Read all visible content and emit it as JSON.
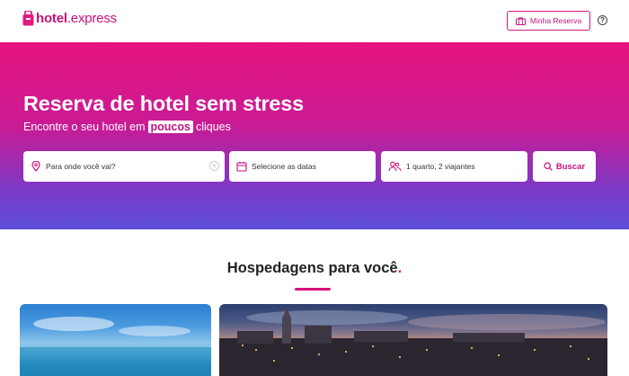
{
  "header": {
    "logo_brand": "hotel",
    "logo_suffix": ".express",
    "my_reservation_label": "Minha Reserva",
    "help_symbol": "?"
  },
  "hero": {
    "title": "Reserva de hotel sem stress",
    "subtitle_before": "Encontre o seu hotel em",
    "subtitle_highlight": "poucos",
    "subtitle_after": "cliques"
  },
  "search": {
    "destination_placeholder": "Para onde você vai?",
    "dates_label": "Selecione as datas",
    "guests_label": "1 quarto, 2 viajantes",
    "search_button": "Buscar"
  },
  "section": {
    "title": "Hospedagens para você",
    "title_dot": "."
  },
  "icons": {
    "logo": "suitcase-logo-icon",
    "my_reservation": "suitcase-icon",
    "help": "help-icon",
    "destination": "location-pin-icon",
    "dates": "calendar-icon",
    "guests": "users-icon",
    "search": "search-icon",
    "clear": "close-circle-icon"
  },
  "colors": {
    "brand": "#c4127e",
    "accent": "#e01a7f",
    "hero_top": "#e8147f",
    "hero_bottom": "#5b4fd9"
  }
}
